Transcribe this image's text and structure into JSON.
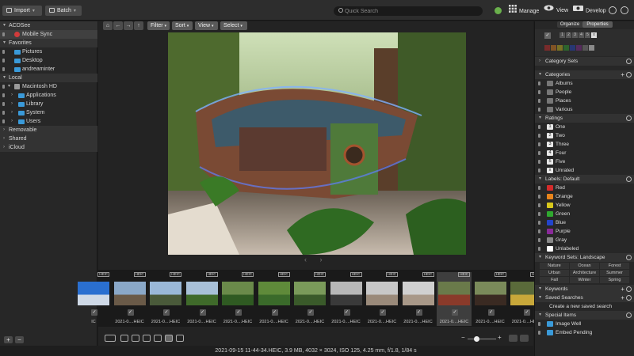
{
  "toolbar": {
    "import_label": "Import",
    "batch_label": "Batch",
    "search_placeholder": "Quick Search",
    "manage_label": "Manage",
    "view_label": "View",
    "develop_label": "Develop"
  },
  "left_panel": {
    "acdsee_header": "ACDSee",
    "mobile_sync": "Mobile Sync",
    "favorites_header": "Favorites",
    "favorites": [
      "Pictures",
      "Desktop",
      "andreaminter"
    ],
    "local_header": "Local",
    "macintosh": "Macintosh HD",
    "folders": [
      "Applications",
      "Library",
      "System",
      "Users"
    ],
    "removable": "Removable",
    "shared": "Shared",
    "icloud": "iCloud",
    "add_button": "+",
    "remove_button": "−"
  },
  "view_toolbar": {
    "filter": "Filter",
    "sort": "Sort",
    "view": "View",
    "select": "Select"
  },
  "filmstrip": {
    "badge": "HEIC",
    "items": [
      {
        "name": "IC",
        "sel": false
      },
      {
        "name": "2021-0....HEIC",
        "sel": false
      },
      {
        "name": "2021-0....HEIC",
        "sel": false
      },
      {
        "name": "2021-0....HEIC",
        "sel": false
      },
      {
        "name": "2021-0....HEIC",
        "sel": false
      },
      {
        "name": "2021-0....HEIC",
        "sel": false
      },
      {
        "name": "2021-0....HEIC",
        "sel": false
      },
      {
        "name": "2021-0....HEIC",
        "sel": false
      },
      {
        "name": "2021-0....HEIC",
        "sel": false
      },
      {
        "name": "2021-0....HEIC",
        "sel": false
      },
      {
        "name": "2021-0....HEIC",
        "sel": true
      },
      {
        "name": "2021-0....HEIC",
        "sel": false
      },
      {
        "name": "2021-0....HEIC",
        "sel": false
      }
    ]
  },
  "status": "2021-09-15 11-44-34.HEIC, 3.9 MB, 4032 × 3024, ISO 125, 4.25 mm, f/1.8, 1/84 s",
  "right_panel": {
    "tab_organize": "Organize",
    "tab_properties": "Properties",
    "rating_boxes": [
      "1",
      "2",
      "3",
      "4",
      "5"
    ],
    "category_sets": "Category Sets",
    "categories_header": "Categories",
    "categories": [
      "Albums",
      "People",
      "Places",
      "Various"
    ],
    "ratings_header": "Ratings",
    "ratings": [
      {
        "num": "1",
        "label": "One"
      },
      {
        "num": "2",
        "label": "Two"
      },
      {
        "num": "3",
        "label": "Three"
      },
      {
        "num": "4",
        "label": "Four"
      },
      {
        "num": "5",
        "label": "Five"
      },
      {
        "num": "x",
        "label": "Unrated"
      }
    ],
    "labels_header": "Labels: Default",
    "labels": [
      {
        "name": "Red",
        "color": "#d42b2b"
      },
      {
        "name": "Orange",
        "color": "#e8841c"
      },
      {
        "name": "Yellow",
        "color": "#d8c81c"
      },
      {
        "name": "Green",
        "color": "#2fa82f"
      },
      {
        "name": "Blue",
        "color": "#2244cc"
      },
      {
        "name": "Purple",
        "color": "#8a2a9a"
      },
      {
        "name": "Gray",
        "color": "#8a8a8a"
      },
      {
        "name": "Unlabeled",
        "color": "#ffffff"
      }
    ],
    "keyword_sets_header": "Keyword Sets: Landscape",
    "keyword_buttons": [
      "Nature",
      "Ocean",
      "Forest",
      "Urban",
      "Architecture",
      "Summer",
      "Fall",
      "Winter",
      "Spring"
    ],
    "keywords_header": "Keywords",
    "saved_searches_header": "Saved Searches",
    "create_saved_search": "Create a new saved search",
    "special_items_header": "Special Items",
    "special_items": [
      "Image Well",
      "Embed Pending"
    ]
  }
}
